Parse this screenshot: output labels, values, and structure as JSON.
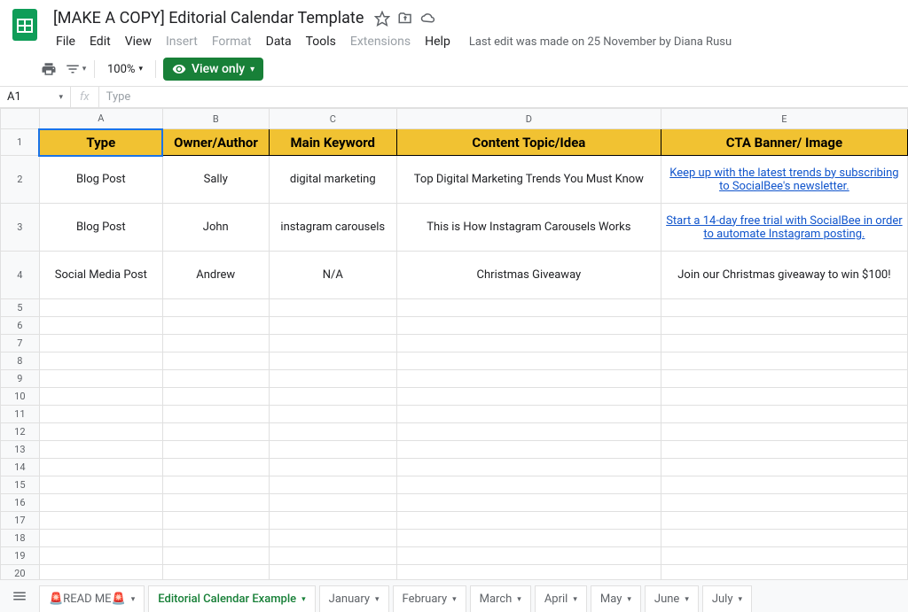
{
  "doc": {
    "title": "[MAKE A COPY] Editorial Calendar Template",
    "last_edit": "Last edit was made on 25 November by Diana Rusu"
  },
  "menu": [
    "File",
    "Edit",
    "View",
    "Insert",
    "Format",
    "Data",
    "Tools",
    "Extensions",
    "Help"
  ],
  "menu_disabled": [
    3,
    4,
    7
  ],
  "toolbar": {
    "zoom": "100%",
    "view_only": "View only"
  },
  "formula": {
    "name_box": "A1",
    "fx": "fx",
    "value": "Type"
  },
  "columns": [
    "A",
    "B",
    "C",
    "D",
    "E"
  ],
  "headers": {
    "A": "Type",
    "B": "Owner/Author",
    "C": "Main Keyword",
    "D": "Content Topic/Idea",
    "E": "CTA Banner/ Image"
  },
  "rows": [
    {
      "num": "2",
      "A": "Blog Post",
      "B": "Sally",
      "C": "digital marketing",
      "D": "Top Digital Marketing Trends You Must Know",
      "E": "Keep up with the latest trends by subscribing to SocialBee's newsletter.",
      "E_link": true
    },
    {
      "num": "3",
      "A": "Blog Post",
      "B": "John",
      "C": "instagram carousels",
      "D": "This is How Instagram Carousels Works",
      "E": "Start a 14-day free trial with SocialBee in order to automate Instagram posting.",
      "E_link": true
    },
    {
      "num": "4",
      "A": "Social Media Post",
      "B": "Andrew",
      "C": "N/A",
      "D": "Christmas Giveaway",
      "E": "Join our Christmas giveaway to win $100!",
      "E_link": false
    }
  ],
  "empty_rows": [
    "5",
    "6",
    "7",
    "8",
    "9",
    "10",
    "11",
    "12",
    "13",
    "14",
    "15",
    "16",
    "17",
    "18",
    "19",
    "20"
  ],
  "sheets": [
    {
      "label": "🚨READ ME🚨",
      "active": false
    },
    {
      "label": "Editorial Calendar Example",
      "active": true
    },
    {
      "label": "January",
      "active": false
    },
    {
      "label": "February",
      "active": false
    },
    {
      "label": "March",
      "active": false
    },
    {
      "label": "April",
      "active": false
    },
    {
      "label": "May",
      "active": false
    },
    {
      "label": "June",
      "active": false
    },
    {
      "label": "July",
      "active": false
    }
  ]
}
